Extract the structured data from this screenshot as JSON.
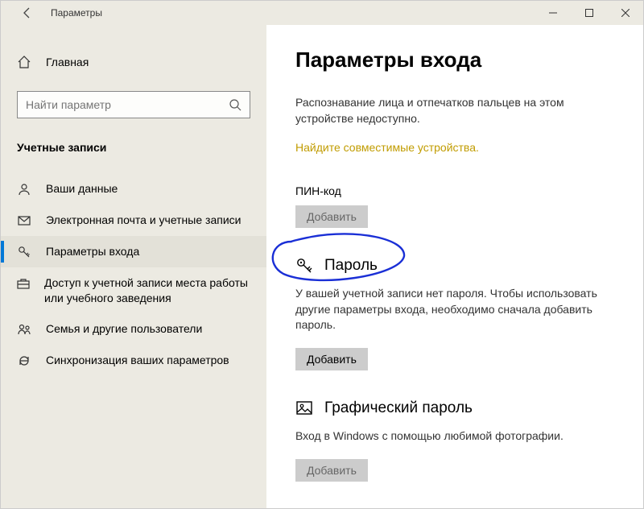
{
  "titlebar": {
    "title": "Параметры"
  },
  "sidebar": {
    "home": "Главная",
    "search_placeholder": "Найти параметр",
    "group": "Учетные записи",
    "items": [
      {
        "label": "Ваши данные"
      },
      {
        "label": "Электронная почта и учетные записи"
      },
      {
        "label": "Параметры входа"
      },
      {
        "label": "Доступ к учетной записи места работы или учебного заведения"
      },
      {
        "label": "Семья и другие пользователи"
      },
      {
        "label": "Синхронизация ваших параметров"
      }
    ]
  },
  "main": {
    "title": "Параметры входа",
    "intro": "Распознавание лица и отпечатков пальцев на этом устройстве недоступно.",
    "link": "Найдите совместимые устройства.",
    "pin": {
      "label": "ПИН-код",
      "button": "Добавить"
    },
    "password": {
      "heading": "Пароль",
      "desc": "У вашей учетной записи нет пароля. Чтобы использовать другие параметры входа, необходимо сначала добавить пароль.",
      "button": "Добавить"
    },
    "picture": {
      "heading": "Графический пароль",
      "desc": "Вход в Windows с помощью любимой фотографии.",
      "button": "Добавить"
    }
  }
}
